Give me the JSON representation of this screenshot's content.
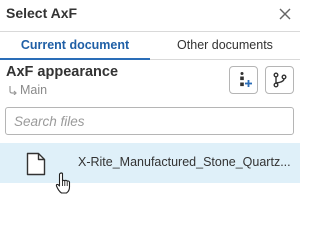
{
  "dialog": {
    "title": "Select AxF",
    "close_icon": "close-icon"
  },
  "tabs": [
    {
      "label": "Current document",
      "active": true
    },
    {
      "label": "Other documents",
      "active": false
    }
  ],
  "header": {
    "title": "AxF appearance",
    "branch_label": "Main",
    "branch_icon": "branch-icon",
    "insert_button_icon": "insert-icon",
    "branch_button_icon": "branch-icon"
  },
  "search": {
    "value": "",
    "placeholder": "Search files"
  },
  "files": [
    {
      "name": "X-Rite_Manufactured_Stone_Quartz...",
      "icon": "document-icon",
      "selected": true
    }
  ],
  "colors": {
    "accent": "#1f5fa6",
    "selected_row": "#dff0f9"
  }
}
